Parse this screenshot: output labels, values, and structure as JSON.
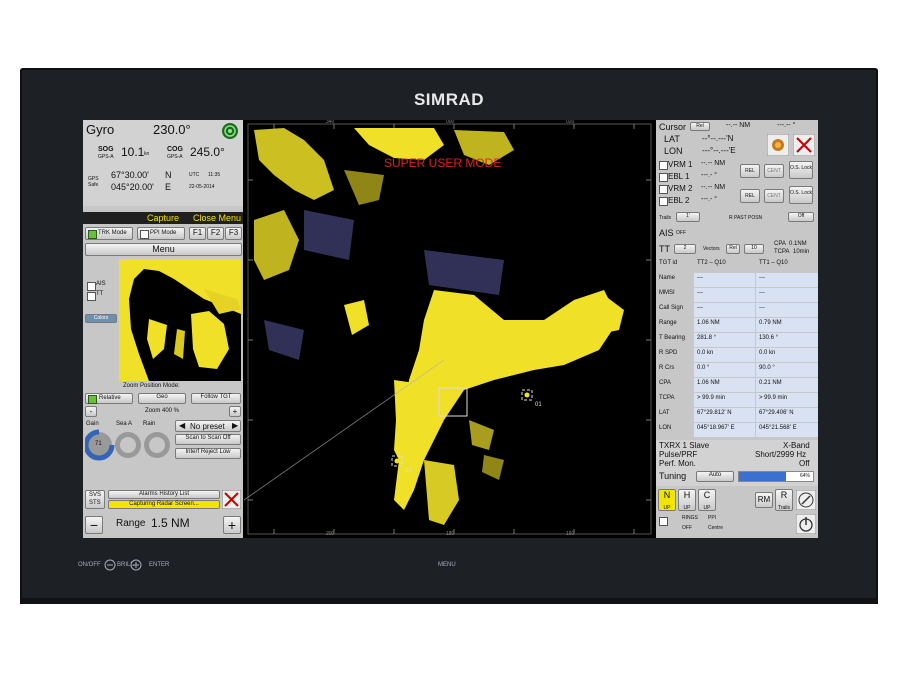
{
  "brand": "SIMRAD",
  "heading": {
    "source": "Gyro",
    "value": "230.0°"
  },
  "sog": {
    "label": "SOG",
    "sub": "GPS-A",
    "value": "10.1",
    "unit": "kn"
  },
  "cog": {
    "label": "COG",
    "sub": "GPS-A",
    "value": "245.0°"
  },
  "gps": {
    "label1": "GPS",
    "label2": "Safe",
    "lat": "67°30.00'",
    "lat_hem": "N",
    "lon": "045°20.00'",
    "lon_hem": "E",
    "utc_label": "UTC",
    "time": "11:35",
    "date": "22-05-2014"
  },
  "toolbar": {
    "capture": "Capture",
    "close_menu": "Close Menu",
    "trk_mode": "TRK Mode",
    "ppi_mode": "PPI Mode",
    "f1": "F1",
    "f2": "F2",
    "f3": "F3",
    "menu": "Menu"
  },
  "zoom": {
    "ais": "AIS",
    "tt": "TT",
    "colors": "Colors",
    "title": "Zoom Position Mode:",
    "relative": "Relative",
    "geo": "Geo",
    "follow": "Follow TGT",
    "minus": "-",
    "value": "Zoom 400 %",
    "plus": "+"
  },
  "gain": {
    "gain_label": "Gain",
    "gain_value": "71",
    "sea_label": "Sea A",
    "rain_label": "Rain",
    "preset": "No preset",
    "scan": "Scan to Scan Off",
    "interf": "Interf Reject Low"
  },
  "alarms": {
    "svs": "SVS",
    "sts": "STS",
    "history": "Alarms History List",
    "capturing": "Capturing Radar Screen..."
  },
  "range": {
    "minus": "−",
    "label": "Range",
    "value": "1.5 NM",
    "plus": "+"
  },
  "radar": {
    "overlay": "SUPER USER MODE",
    "target1": "01",
    "target2": "02",
    "bearings": [
      "340",
      "000",
      "020",
      "200",
      "180",
      "160"
    ]
  },
  "cursor": {
    "label": "Cursor",
    "mode": "Rel",
    "range": "--.-- NM",
    "bearing": "---.-- °",
    "lat_label": "LAT",
    "lat": "--°--.---'N",
    "lon_label": "LON",
    "lon": "---°--.---'E"
  },
  "vrm_ebl": [
    {
      "label": "VRM 1",
      "value": "--.-- NM"
    },
    {
      "label": "EBL 1",
      "value": "---.- °"
    },
    {
      "label": "VRM 2",
      "value": "--.-- NM"
    },
    {
      "label": "EBL 2",
      "value": "---.- °"
    }
  ],
  "vrm_btn": {
    "rel": "REL",
    "cent": "CENT",
    "os_lock": "O.S. Lock"
  },
  "trails": {
    "label": "Trails",
    "value": "1'",
    "mode": "R PAST POSN",
    "state": "Off"
  },
  "ais": {
    "label": "AIS",
    "state": "OFF"
  },
  "tt": {
    "label": "TT",
    "count": "2",
    "vectors": "Vectors",
    "mode": "Rel",
    "minutes": "10",
    "cpa": "CPA",
    "cpa_val": "0.1NM",
    "tcpa": "TCPA",
    "tcpa_val": "10min"
  },
  "target_table": {
    "headers": [
      "TGT id",
      "TT2 – Q10",
      "TT1 – Q10"
    ],
    "rows": [
      {
        "label": "Name",
        "a": "---",
        "b": "---"
      },
      {
        "label": "MMSI",
        "a": "---",
        "b": "---"
      },
      {
        "label": "Call Sign",
        "a": "---",
        "b": "---"
      },
      {
        "label": "Range",
        "a": "1.06 NM",
        "b": "0.79 NM"
      },
      {
        "label": "T Bearing",
        "a": "281.8 °",
        "b": "130.6 °"
      },
      {
        "label": "R SPD",
        "a": "0.0 kn",
        "b": "0.0 kn"
      },
      {
        "label": "R Crs",
        "a": "0.0 °",
        "b": "90.0 °"
      },
      {
        "label": "CPA",
        "a": "1.06 NM",
        "b": "0.21 NM"
      },
      {
        "label": "TCPA",
        "a": "> 99.9 min",
        "b": "> 99.9 min"
      },
      {
        "label": "LAT",
        "a": "67°29.812' N",
        "b": "67°29.406' N"
      },
      {
        "label": "LON",
        "a": "045°18.967' E",
        "b": "045°21.568' E"
      }
    ]
  },
  "txrx": {
    "label": "TXRX 1 Slave",
    "band": "X-Band",
    "pulse_label": "Pulse/PRF",
    "pulse": "Short/2999 Hz",
    "perf_label": "Perf. Mon.",
    "perf": "Off",
    "tuning": "Tuning",
    "auto": "Auto",
    "tuning_pct": "64%",
    "tuning_level": 0.64
  },
  "bottom_right": {
    "n": "N",
    "n_sub": "UP",
    "h": "H",
    "h_sub": "UP",
    "c": "C",
    "c_sub": "UP",
    "rm": "RM",
    "r": "R",
    "r_sub": "Trails",
    "rings": "RINGS",
    "rings_state": "OFF",
    "ppi": "PPI",
    "ppi_state": "Centre"
  },
  "bezel": {
    "onoff": "ON/OFF",
    "brill": "BRILL",
    "enter": "ENTER",
    "menu": "MENU"
  },
  "colors": {
    "echo": "#f0e028",
    "panel": "#c7c7c7",
    "accent_green": "#6bbf3a",
    "tuning_blue": "#3b6fd0"
  }
}
